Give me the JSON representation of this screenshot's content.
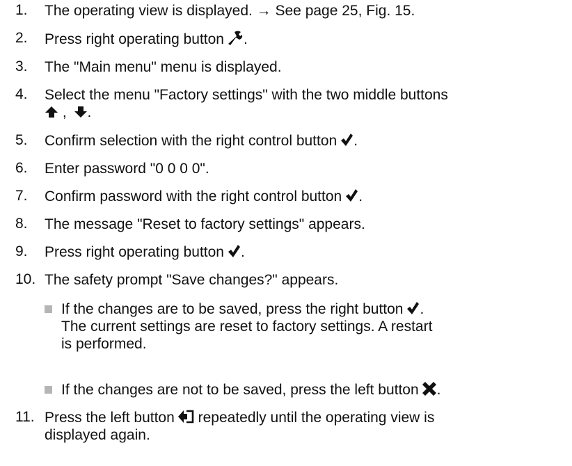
{
  "steps": [
    {
      "num": "1.",
      "text": "The operating view is displayed. → See page 25, Fig. 15."
    },
    {
      "num": "2.",
      "text": "Press right operating button",
      "icon": "wrench-icon",
      "after": "."
    },
    {
      "num": "3.",
      "text": "The \"Main menu\" menu is displayed."
    },
    {
      "num": "4.",
      "text": "Select the menu \"Factory settings\" with the two middle buttons",
      "line2_sep": ",",
      "after": "."
    },
    {
      "num": "5.",
      "text": "Confirm selection with the right control button",
      "icon": "checkmark-icon",
      "after": "."
    },
    {
      "num": "6.",
      "text": "Enter password \"0 0 0 0\"."
    },
    {
      "num": "7.",
      "text": "Confirm password with the right control button",
      "icon": "checkmark-icon",
      "after": "."
    },
    {
      "num": "8.",
      "text": "The message \"Reset to factory settings\" appears."
    },
    {
      "num": "9.",
      "text": "Press right operating button",
      "icon": "checkmark-icon",
      "after": "."
    },
    {
      "num": "10.",
      "text": "The safety prompt \"Save changes?\" appears."
    },
    {
      "num": "11.",
      "text": "Press the left button",
      "icon": "back-icon",
      "text_after": "repeatedly until the operating view is",
      "line2": "displayed again."
    }
  ],
  "sub_items": [
    {
      "line1": "If the changes are to be saved, press the right button",
      "icon": "checkmark-icon",
      "after": ".",
      "line2": "The current settings are reset to factory settings. A restart",
      "line3": "is performed."
    },
    {
      "line1": "If the changes are not to be saved, press the left button",
      "icon": "cross-icon",
      "after": "."
    }
  ]
}
